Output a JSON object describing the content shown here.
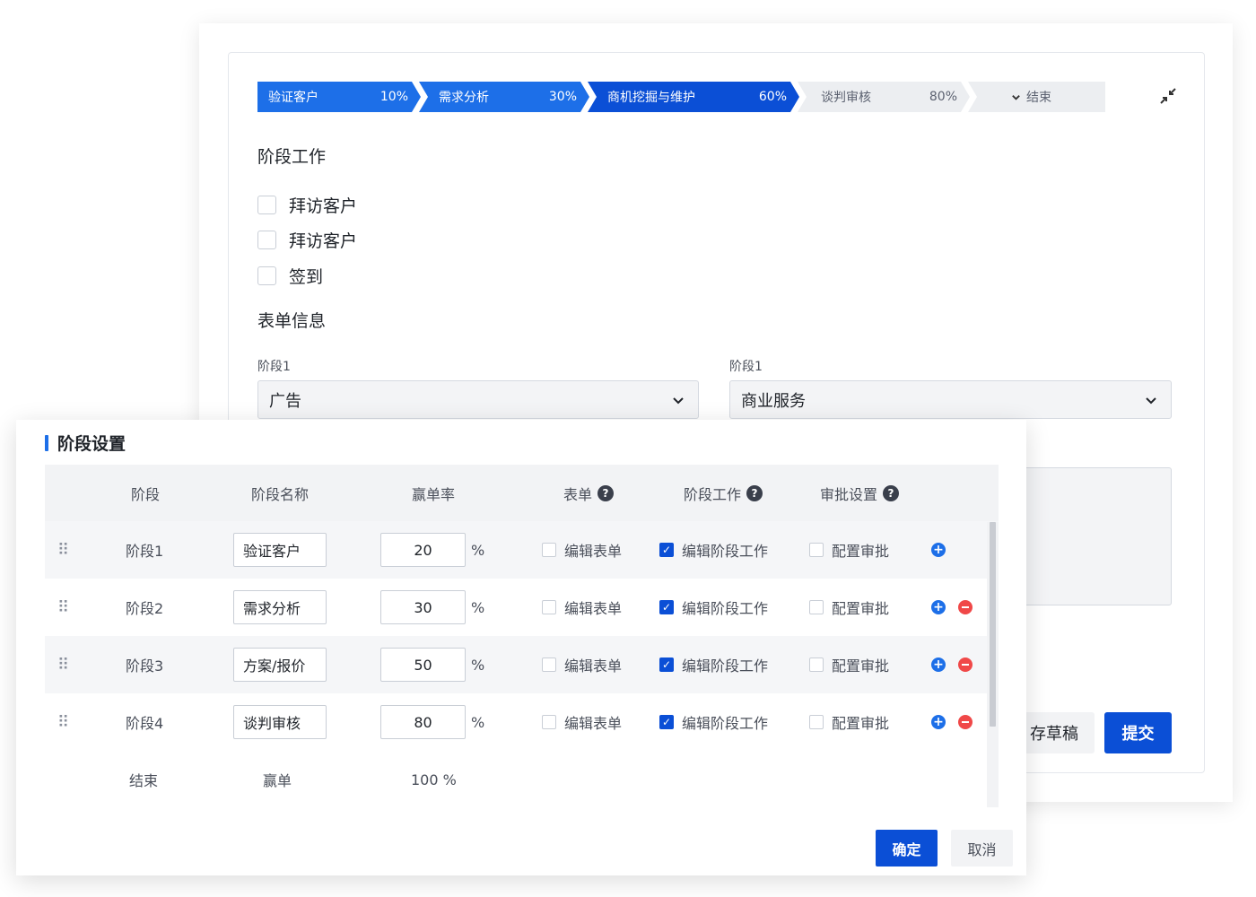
{
  "stage_bar": {
    "stages": [
      {
        "label": "验证客户",
        "percent": "10%"
      },
      {
        "label": "需求分析",
        "percent": "30%"
      },
      {
        "label": "商机挖掘与维护",
        "percent": "60%"
      },
      {
        "label": "谈判审核",
        "percent": "80%"
      },
      {
        "label": "结束",
        "percent": ""
      }
    ],
    "collapse_icon": "collapse-arrows-icon"
  },
  "stage_work": {
    "title": "阶段工作",
    "items": [
      "拜访客户",
      "拜访客户",
      "签到"
    ]
  },
  "form_info": {
    "title": "表单信息",
    "field1": {
      "label": "阶段1",
      "value": "广告"
    },
    "field2": {
      "label": "阶段1",
      "value": "商业服务"
    }
  },
  "footer_back": {
    "draft_label": "存草稿",
    "submit_label": "提交"
  },
  "modal": {
    "title": "阶段设置",
    "columns": {
      "stage": "阶段",
      "name": "阶段名称",
      "rate": "赢单率",
      "form": "表单",
      "work": "阶段工作",
      "approval": "审批设置"
    },
    "rows": [
      {
        "stage": "阶段1",
        "name": "验证客户",
        "rate": "20",
        "unit": "%",
        "form": "编辑表单",
        "work": "编辑阶段工作",
        "approval": "配置审批"
      },
      {
        "stage": "阶段2",
        "name": "需求分析",
        "rate": "30",
        "unit": "%",
        "form": "编辑表单",
        "work": "编辑阶段工作",
        "approval": "配置审批"
      },
      {
        "stage": "阶段3",
        "name": "方案/报价",
        "rate": "50",
        "unit": "%",
        "form": "编辑表单",
        "work": "编辑阶段工作",
        "approval": "配置审批"
      },
      {
        "stage": "阶段4",
        "name": "谈判审核",
        "rate": "80",
        "unit": "%",
        "form": "编辑表单",
        "work": "编辑阶段工作",
        "approval": "配置审批"
      }
    ],
    "end_row": {
      "stage": "结束",
      "name": "赢单",
      "rate": "100 %"
    },
    "ok_label": "确定",
    "cancel_label": "取消",
    "colors": {
      "primary": "#0b4fd6",
      "accent": "#1d6fe8",
      "danger": "#f04848"
    }
  }
}
